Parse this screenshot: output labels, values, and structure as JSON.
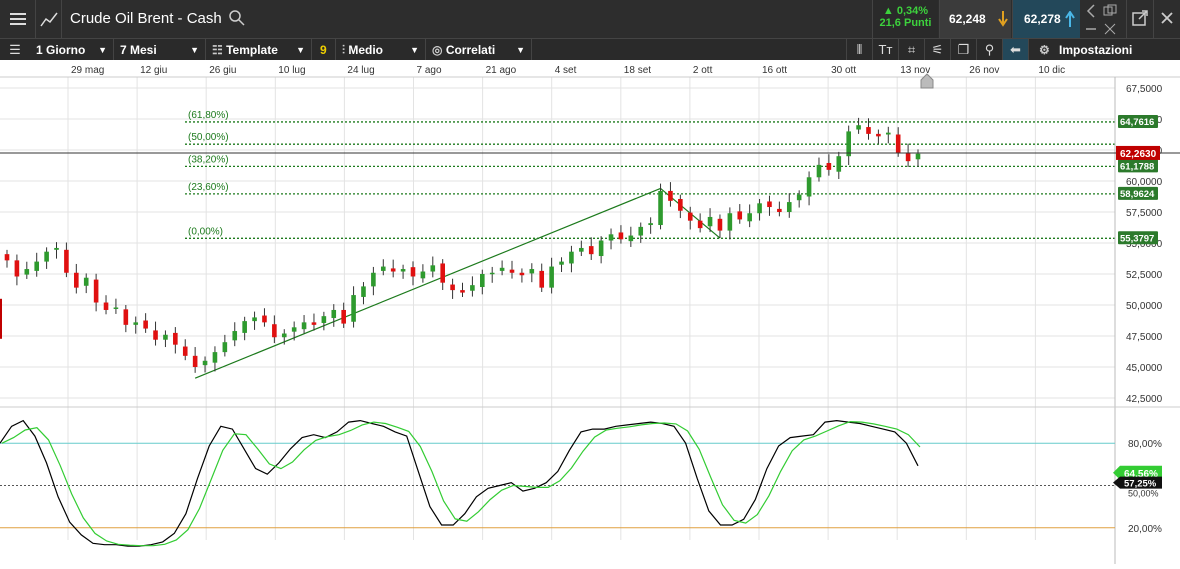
{
  "header": {
    "instrument_title": "Crude Oil Brent - Cash",
    "change_percent": "▲ 0,34%",
    "change_points": "21,6 Punti",
    "bid": "62,248",
    "ask": "62,278"
  },
  "toolbar": {
    "timeframe": "1 Giorno",
    "range": "7 Mesi",
    "template": "Template",
    "badge": "9",
    "indicator": "Medio",
    "related": "Correlati",
    "settings": "Impostazioni"
  },
  "colors": {
    "up": "#2e9a2e",
    "down": "#e01010",
    "fib": "#1c7a1c",
    "stoch_k": "#000000",
    "stoch_d": "#33cc33",
    "upper_band": "#66cccc",
    "lower_band": "#e0a040",
    "price_tag": "#c00000"
  },
  "chart_data": [
    {
      "type": "candlestick",
      "x_ticks": [
        "29 mag",
        "12 giu",
        "26 giu",
        "10 lug",
        "24 lug",
        "7 ago",
        "21 ago",
        "4 set",
        "18 set",
        "2 ott",
        "16 ott",
        "30 ott",
        "13 nov",
        "26 nov",
        "10 dic"
      ],
      "y_ticks": [
        "67,5000",
        "65,0000",
        "62,5000",
        "60,0000",
        "57,5000",
        "55,0000",
        "52,5000",
        "50,0000",
        "47,5000",
        "45,0000",
        "42,5000"
      ],
      "ylim": [
        42.5,
        67.5
      ],
      "current_price": "62,2630",
      "fibonacci": [
        {
          "label": "(61,80%)",
          "value": 64.7616,
          "tag": "64,7616"
        },
        {
          "label": "(50,00%)",
          "value": 62.97,
          "tag": ""
        },
        {
          "label": "(38,20%)",
          "value": 61.1788,
          "tag": "61,1788"
        },
        {
          "label": "(23,60%)",
          "value": 58.9624,
          "tag": "58,9624"
        },
        {
          "label": "(0,00%)",
          "value": 55.3797,
          "tag": "55,3797"
        }
      ],
      "closes": [
        53.6,
        52.3,
        52.9,
        53.5,
        54.3,
        54.6,
        52.6,
        51.4,
        52.2,
        50.2,
        49.6,
        49.8,
        48.4,
        48.6,
        48.1,
        47.2,
        47.6,
        46.8,
        45.9,
        45.0,
        45.5,
        46.2,
        47.0,
        47.9,
        48.7,
        49.0,
        48.6,
        47.4,
        47.7,
        48.2,
        48.6,
        48.4,
        49.1,
        49.6,
        48.5,
        50.8,
        51.5,
        52.6,
        53.1,
        52.7,
        52.9,
        52.3,
        52.7,
        53.2,
        51.8,
        51.2,
        51.0,
        51.6,
        52.5,
        52.6,
        53.0,
        52.6,
        52.4,
        52.9,
        51.4,
        53.1,
        53.5,
        54.3,
        54.6,
        54.1,
        55.2,
        55.7,
        55.3,
        55.6,
        56.3,
        56.6,
        59.2,
        58.4,
        57.6,
        56.8,
        56.2,
        57.1,
        56.0,
        57.4,
        56.9,
        57.4,
        58.2,
        57.9,
        57.5,
        58.3,
        58.9,
        60.3,
        61.3,
        60.9,
        62.0,
        64.0,
        64.5,
        63.8,
        63.6,
        63.9,
        62.3,
        61.6,
        62.2
      ]
    },
    {
      "type": "line",
      "title": "",
      "series": [
        {
          "name": "",
          "values": [
            80,
            92,
            96,
            85,
            66,
            42,
            24,
            15,
            9,
            8,
            8,
            7,
            7,
            8,
            10,
            16,
            30,
            55,
            78,
            92,
            90,
            76,
            62,
            58,
            66,
            76,
            84,
            86,
            84,
            88,
            95,
            96,
            94,
            92,
            88,
            85,
            60,
            35,
            22,
            22,
            30,
            42,
            48,
            50,
            52,
            46,
            48,
            52,
            60,
            75,
            88,
            90,
            90,
            92,
            93,
            94,
            95,
            94,
            92,
            80,
            55,
            32,
            22,
            22,
            26,
            40,
            62,
            78,
            84,
            85,
            86,
            95,
            96,
            95,
            94,
            92,
            90,
            88,
            80,
            64
          ]
        }
      ],
      "y_ticks": [
        "80,00%",
        "20,00%"
      ],
      "ylim": [
        0,
        100
      ],
      "k_label": "64,56%",
      "d_label": "57,25%",
      "mid_label": "50,00%"
    }
  ]
}
